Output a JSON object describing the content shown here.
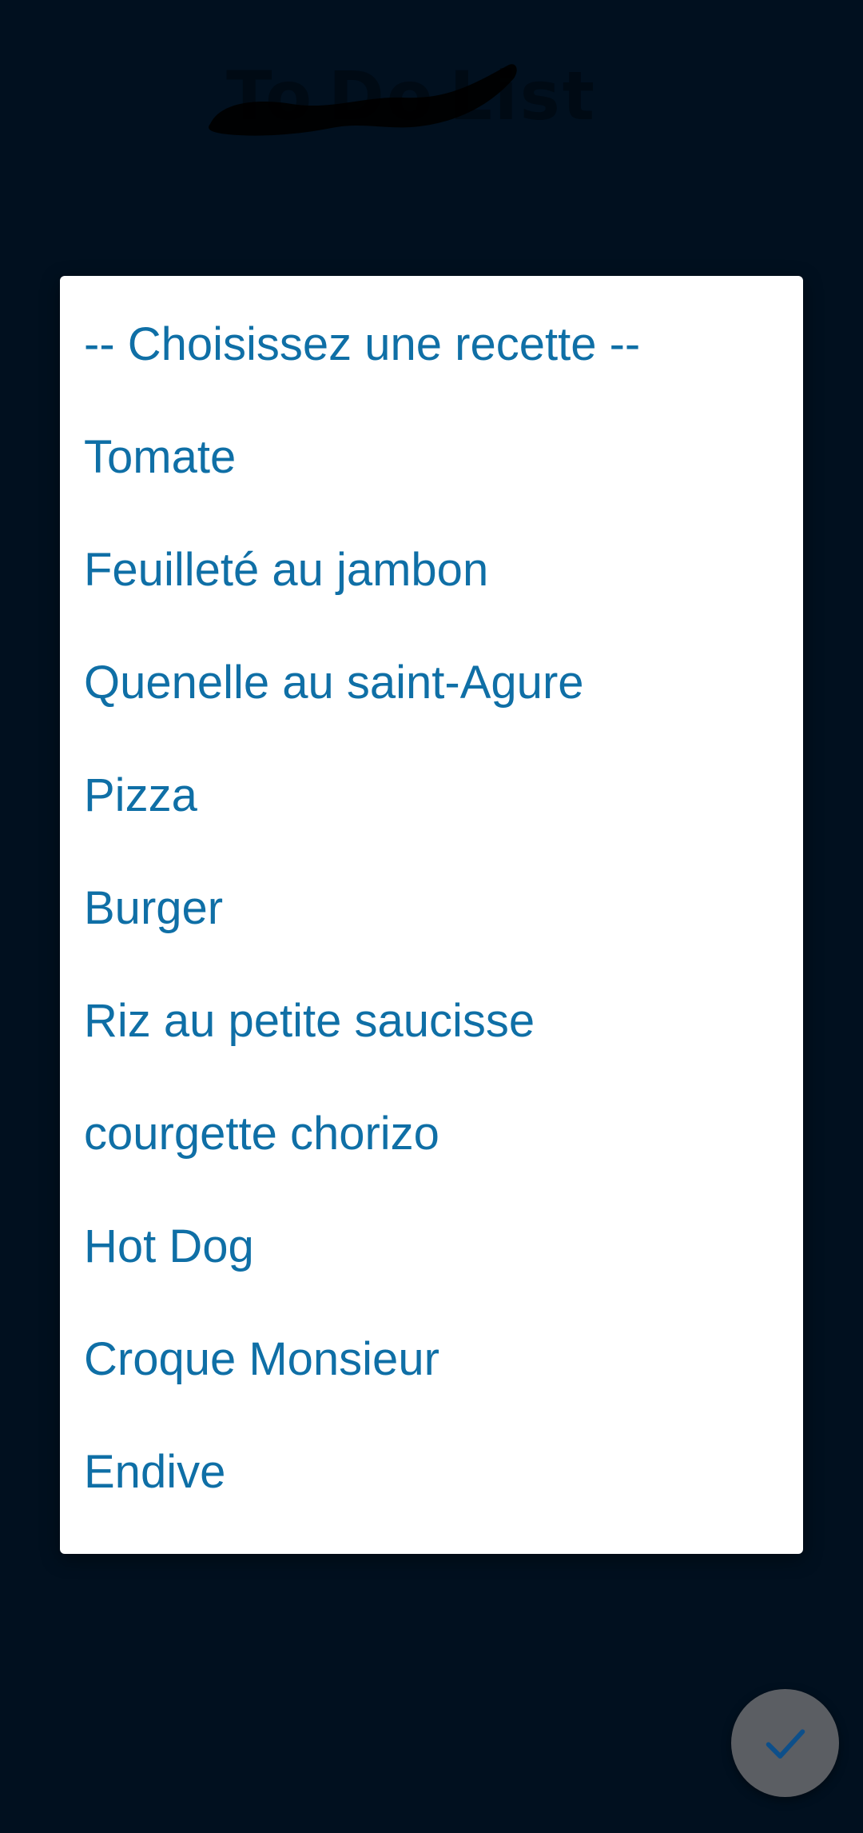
{
  "app": {
    "logo_text": "ToDo List",
    "logo_words": [
      "To",
      "Do",
      "List"
    ]
  },
  "select_dialog": {
    "options": [
      "-- Choisissez une recette --",
      "Tomate",
      "Feuilleté au jambon",
      "Quenelle au saint-Agure",
      "Pizza",
      "Burger",
      "Riz au petite saucisse",
      "courgette chorizo",
      "Hot Dog",
      "Croque Monsieur",
      "Endive"
    ]
  },
  "fab": {
    "icon": "check-icon"
  },
  "colors": {
    "background": "#01101f",
    "dialog": "#ffffff",
    "option_text": "#0f6fa6",
    "fab": "#5b5e63",
    "fab_icon": "#0d4f8a"
  }
}
